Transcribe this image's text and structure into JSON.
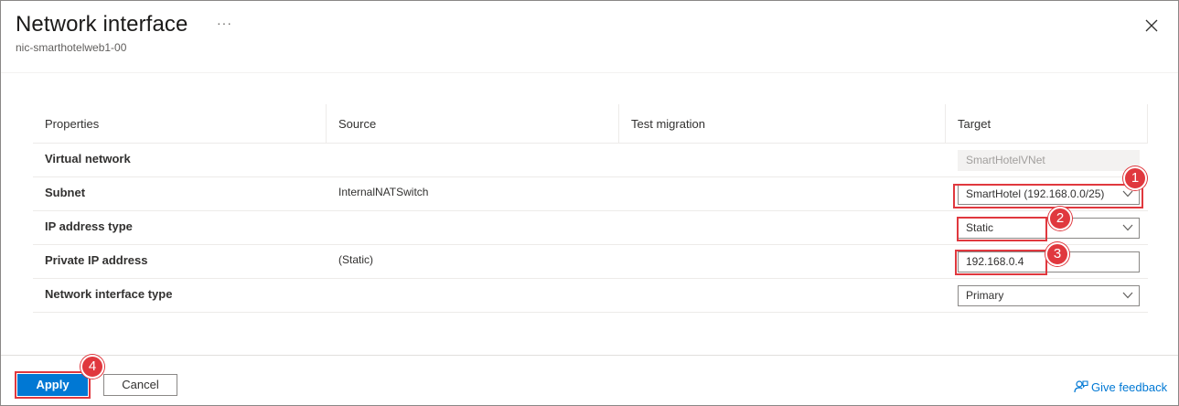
{
  "header": {
    "title": "Network interface",
    "more_label": "···",
    "subtitle": "nic-smarthotelweb1-00",
    "close_icon": "close-icon"
  },
  "table": {
    "columns": [
      "Properties",
      "Source",
      "Test migration",
      "Target"
    ],
    "rows": [
      {
        "property": "Virtual network",
        "source": "",
        "test": "",
        "target": "SmartHotelVNet",
        "target_kind": "disabled-input"
      },
      {
        "property": "Subnet",
        "source": "InternalNATSwitch",
        "test": "",
        "target": "SmartHotel (192.168.0.0/25)",
        "target_kind": "dropdown"
      },
      {
        "property": "IP address type",
        "source": "",
        "test": "",
        "target": "Static",
        "target_kind": "dropdown"
      },
      {
        "property": "Private IP address",
        "source": "(Static)",
        "test": "",
        "target": "192.168.0.4",
        "target_kind": "input"
      },
      {
        "property": "Network interface type",
        "source": "",
        "test": "",
        "target": "Primary",
        "target_kind": "dropdown"
      }
    ]
  },
  "callouts": [
    "1",
    "2",
    "3",
    "4"
  ],
  "footer": {
    "apply_label": "Apply",
    "cancel_label": "Cancel",
    "feedback_label": "Give feedback",
    "feedback_icon": "feedback-person-icon"
  },
  "colors": {
    "accent": "#0078d4",
    "callout": "#e0383e",
    "disabled_bg": "#f3f2f1"
  }
}
